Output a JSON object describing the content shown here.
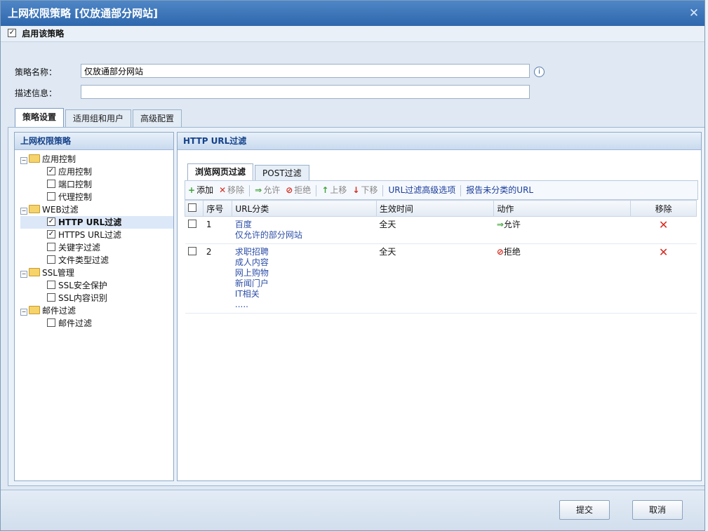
{
  "window": {
    "title": "上网权限策略 [仅放通部分网站]",
    "close_label": "✕"
  },
  "enable": {
    "label": "启用该策略",
    "checked": true
  },
  "form": {
    "name_label": "策略名称：",
    "name_value": "仅放通部分网站",
    "desc_label": "描述信息：",
    "desc_value": ""
  },
  "tabs": [
    {
      "label": "策略设置",
      "active": true
    },
    {
      "label": "适用组和用户",
      "active": false
    },
    {
      "label": "高级配置",
      "active": false
    }
  ],
  "left_panel": {
    "header": "上网权限策略",
    "tree": [
      {
        "label": "应用控制",
        "level": 1,
        "type": "folder"
      },
      {
        "label": "应用控制",
        "level": 2,
        "checked": true
      },
      {
        "label": "端口控制",
        "level": 2,
        "checked": false
      },
      {
        "label": "代理控制",
        "level": 2,
        "checked": false
      },
      {
        "label": "WEB过滤",
        "level": 1,
        "type": "folder"
      },
      {
        "label": "HTTP URL过滤",
        "level": 2,
        "checked": true,
        "selected": true
      },
      {
        "label": "HTTPS URL过滤",
        "level": 2,
        "checked": true
      },
      {
        "label": "关键字过滤",
        "level": 2,
        "checked": false
      },
      {
        "label": "文件类型过滤",
        "level": 2,
        "checked": false
      },
      {
        "label": "SSL管理",
        "level": 1,
        "type": "folder"
      },
      {
        "label": "SSL安全保护",
        "level": 2,
        "checked": false
      },
      {
        "label": "SSL内容识别",
        "level": 2,
        "checked": false
      },
      {
        "label": "邮件过滤",
        "level": 1,
        "type": "folder"
      },
      {
        "label": "邮件过滤",
        "level": 2,
        "checked": false
      }
    ]
  },
  "right_panel": {
    "header": "HTTP URL过滤",
    "subtabs": [
      {
        "label": "浏览网页过滤",
        "active": true
      },
      {
        "label": "POST过滤",
        "active": false
      }
    ],
    "toolbar": {
      "add": "添加",
      "remove": "移除",
      "allow": "允许",
      "deny": "拒绝",
      "up": "上移",
      "down": "下移",
      "advanced": "URL过滤高级选项",
      "report": "报告未分类的URL"
    },
    "table": {
      "headers": {
        "seq": "序号",
        "category": "URL分类",
        "time": "生效时间",
        "action": "动作",
        "remove": "移除"
      },
      "rows": [
        {
          "seq": "1",
          "categories": [
            "百度",
            "仅允许的部分网站"
          ],
          "time": "全天",
          "action": "允许",
          "action_type": "allow"
        },
        {
          "seq": "2",
          "categories": [
            "求职招聘",
            "成人内容",
            "网上购物",
            "新闻门户",
            "IT相关",
            "....."
          ],
          "time": "全天",
          "action": "拒绝",
          "action_type": "deny"
        }
      ]
    }
  },
  "footer": {
    "submit": "提交",
    "cancel": "取消"
  },
  "colors": {
    "title_bar": "#2f67ad",
    "link": "#2d4fa8",
    "allow": "#3fa33a",
    "deny": "#d52a1e"
  }
}
